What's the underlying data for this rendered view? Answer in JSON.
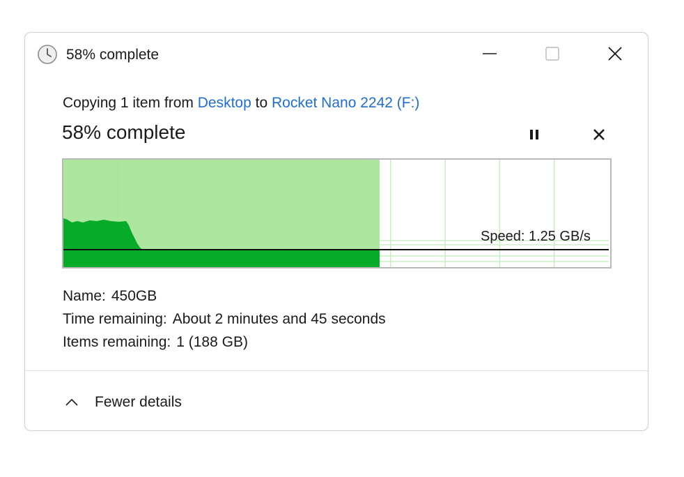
{
  "window": {
    "title": "58% complete",
    "icon": "clock-icon",
    "controls": {
      "minimize": "minimize-icon",
      "maximize": "maximize-icon",
      "close": "close-icon"
    }
  },
  "operation": {
    "prefix": "Copying 1 item from ",
    "source": "Desktop",
    "to_word": " to ",
    "destination": "Rocket Nano 2242 (F:)",
    "heading": "58% complete",
    "progress_fraction": 0.58
  },
  "graph": {
    "speed_label": "Speed: 1.25 GB/s",
    "colors": {
      "completed_fill": "#a8e59a",
      "speed_fill": "#06ab2a",
      "grid": "#c6ebc0",
      "border": "#b9b9b9",
      "current_speed_line": "#111111"
    }
  },
  "details": {
    "name_label": "Name:",
    "name_value": "450GB",
    "time_label": "Time remaining:",
    "time_value": "About 2 minutes and 45 seconds",
    "items_label": "Items remaining:",
    "items_value": "1 (188 GB)"
  },
  "footer": {
    "toggle_label": "Fewer details",
    "toggle_icon": "chevron-up-icon"
  },
  "accent_color": "#1f6fd1"
}
